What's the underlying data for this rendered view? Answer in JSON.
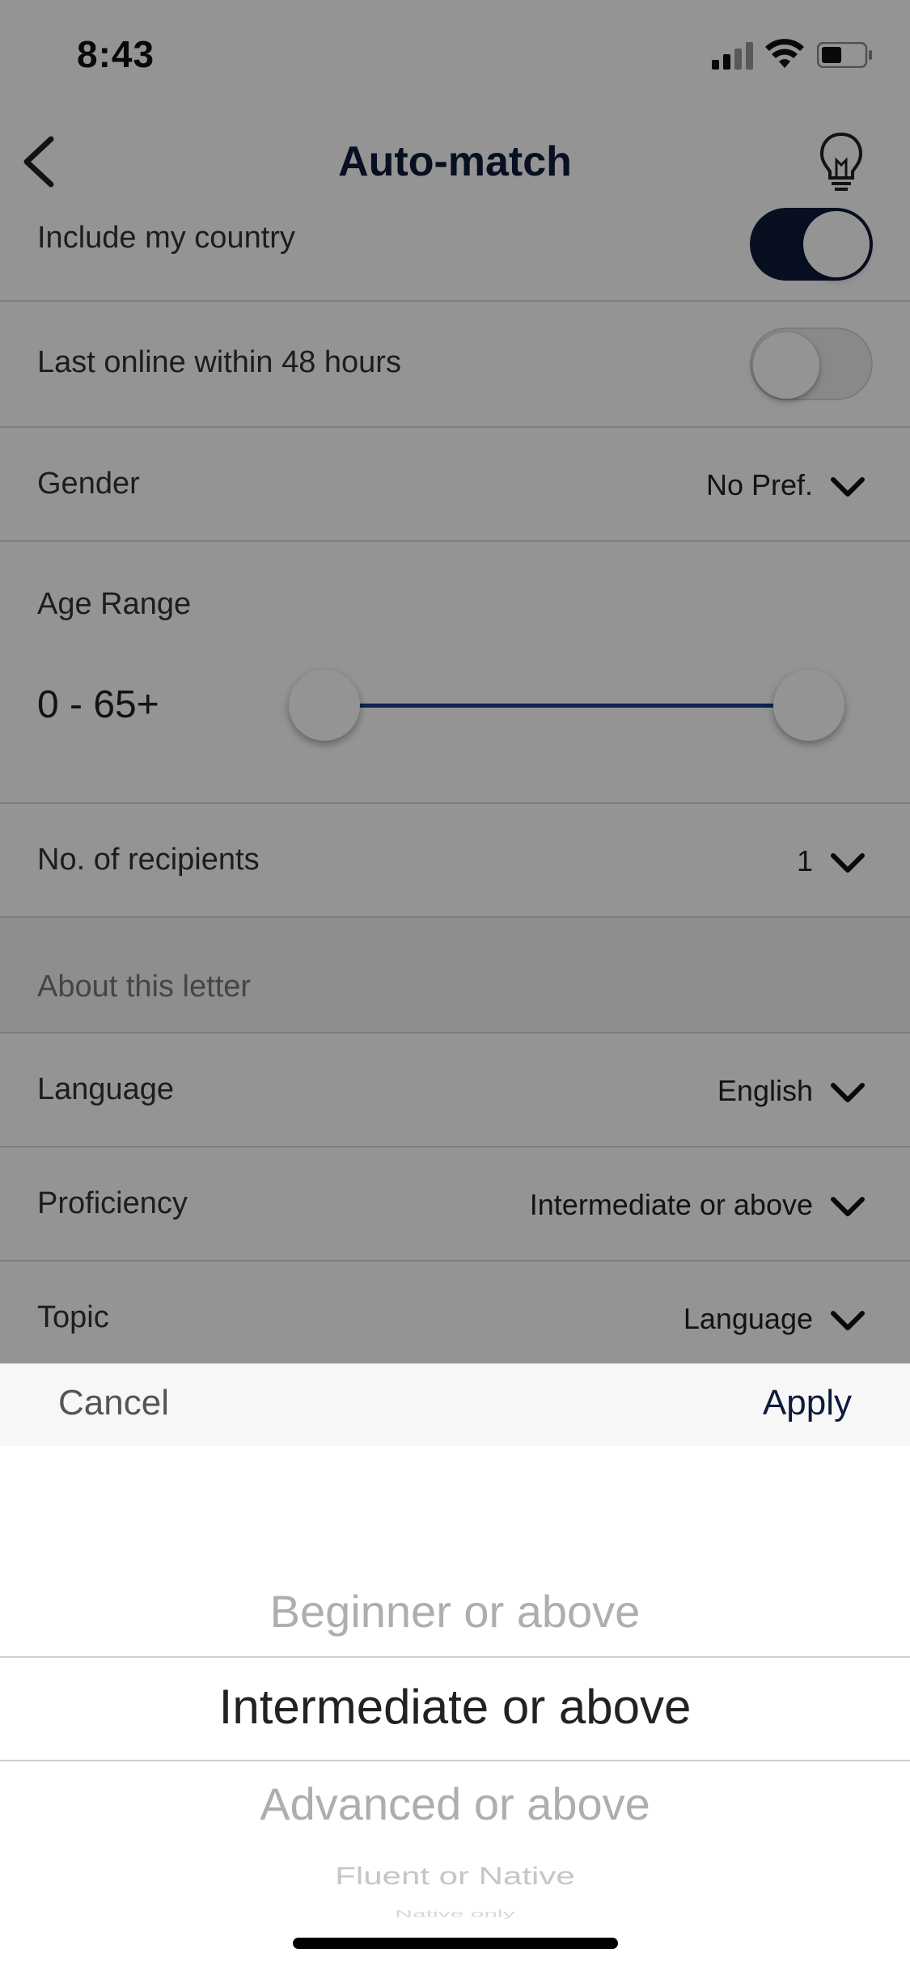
{
  "status_bar": {
    "time": "8:43"
  },
  "navbar": {
    "title": "Auto-match"
  },
  "rows": {
    "include_country": {
      "label": "Include my country",
      "toggle_on": true
    },
    "last_online": {
      "label": "Last online within 48 hours",
      "toggle_on": false
    },
    "gender": {
      "label": "Gender",
      "value": "No Pref."
    },
    "age_range": {
      "label": "Age Range",
      "value": "0 - 65+"
    },
    "recipients": {
      "label": "No. of recipients",
      "value": "1"
    },
    "about_section": {
      "label": "About this letter"
    },
    "language": {
      "label": "Language",
      "value": "English"
    },
    "proficiency": {
      "label": "Proficiency",
      "value": "Intermediate or above"
    },
    "topic": {
      "label": "Topic",
      "value": "Language"
    }
  },
  "picker": {
    "cancel_label": "Cancel",
    "apply_label": "Apply",
    "options": [
      "Beginner or above",
      "Intermediate or above",
      "Advanced or above",
      "Fluent or Native",
      "Native only"
    ],
    "selected_index": 1
  },
  "colors": {
    "accent": "#0d1a3a",
    "slider": "#1a3c8c"
  }
}
